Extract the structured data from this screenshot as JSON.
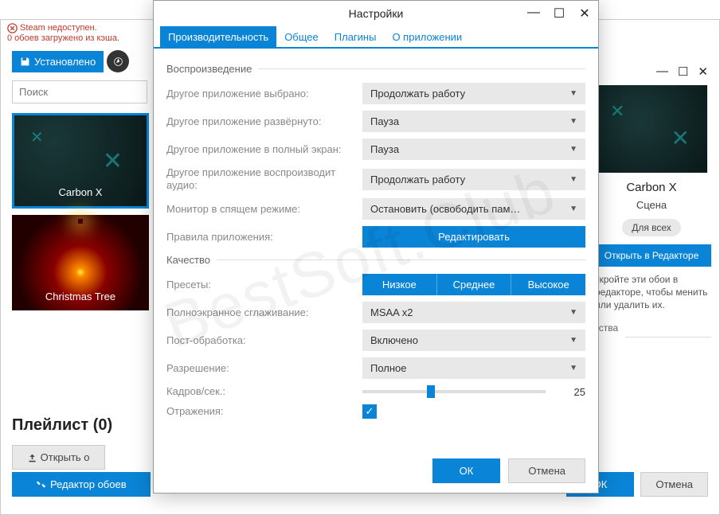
{
  "bg": {
    "err1": "Steam недоступен.",
    "err2": "0 обоев загружено из кэша.",
    "installed": "Установлено",
    "search_ph": "Поиск",
    "thumb1": "Carbon X",
    "thumb2": "Christmas Tree",
    "playlist": "Плейлист (0)",
    "open_btn": "Открыть о",
    "editor_btn": "Редактор обоев",
    "ok": "ОК",
    "cancel": "Отмена"
  },
  "right": {
    "title": "Carbon X",
    "subtitle": "Сцена",
    "badge": "Для всех",
    "open_editor": "Открыть в Редакторе",
    "desc": "ткройте эти обои в редакторе, чтобы менить или удалить их.",
    "props": "йства"
  },
  "modal": {
    "title": "Настройки",
    "tabs": {
      "perf": "Производительность",
      "general": "Общее",
      "plugins": "Плагины",
      "about": "О приложении"
    },
    "section_playback": "Воспроизведение",
    "app_focused_label": "Другое приложение выбрано:",
    "app_focused_val": "Продолжать работу",
    "app_maximized_label": "Другое приложение развёрнуто:",
    "app_maximized_val": "Пауза",
    "app_fullscreen_label": "Другое приложение в полный экран:",
    "app_fullscreen_val": "Пауза",
    "app_audio_label": "Другое приложение воспроизводит аудио:",
    "app_audio_val": "Продолжать работу",
    "monitor_sleep_label": "Монитор в спящем режиме:",
    "monitor_sleep_val": "Остановить (освободить пам…",
    "app_rules_label": "Правила приложения:",
    "app_rules_btn": "Редактировать",
    "section_quality": "Качество",
    "presets_label": "Пресеты:",
    "preset_low": "Низкое",
    "preset_med": "Среднее",
    "preset_high": "Высокое",
    "aa_label": "Полноэкранное сглаживание:",
    "aa_val": "MSAA x2",
    "post_label": "Пост-обработка:",
    "post_val": "Включено",
    "res_label": "Разрешение:",
    "res_val": "Полное",
    "fps_label": "Кадров/сек.:",
    "fps_val": "25",
    "refl_label": "Отражения:",
    "ok": "ОК",
    "cancel": "Отмена"
  },
  "watermark": "BestSoft.Club"
}
